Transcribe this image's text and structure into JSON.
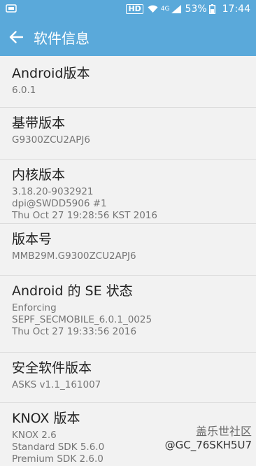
{
  "status_bar": {
    "hd": "HD",
    "network": "4G",
    "battery": "53%",
    "time": "17:44"
  },
  "header": {
    "title": "软件信息"
  },
  "items": [
    {
      "title": "Android版本",
      "lines": [
        "6.0.1"
      ]
    },
    {
      "title": "基带版本",
      "lines": [
        "G9300ZCU2APJ6"
      ]
    },
    {
      "title": "内核版本",
      "lines": [
        "3.18.20-9032921",
        "dpi@SWDD5906 #1",
        "Thu Oct 27 19:28:56 KST 2016"
      ]
    },
    {
      "title": "版本号",
      "lines": [
        "MMB29M.G9300ZCU2APJ6"
      ]
    },
    {
      "title": "Android 的 SE 状态",
      "lines": [
        "Enforcing",
        "SEPF_SECMOBILE_6.0.1_0025",
        "Thu Oct 27 19:33:56 2016"
      ]
    },
    {
      "title": "安全软件版本",
      "lines": [
        "ASKS v1.1_161007"
      ]
    },
    {
      "title": "KNOX 版本",
      "lines": [
        "KNOX 2.6",
        "Standard SDK 5.6.0",
        "Premium SDK 2.6.0"
      ]
    }
  ],
  "watermark": {
    "logo": "盖乐世社区",
    "user": "@GC_76SKH5U7"
  }
}
